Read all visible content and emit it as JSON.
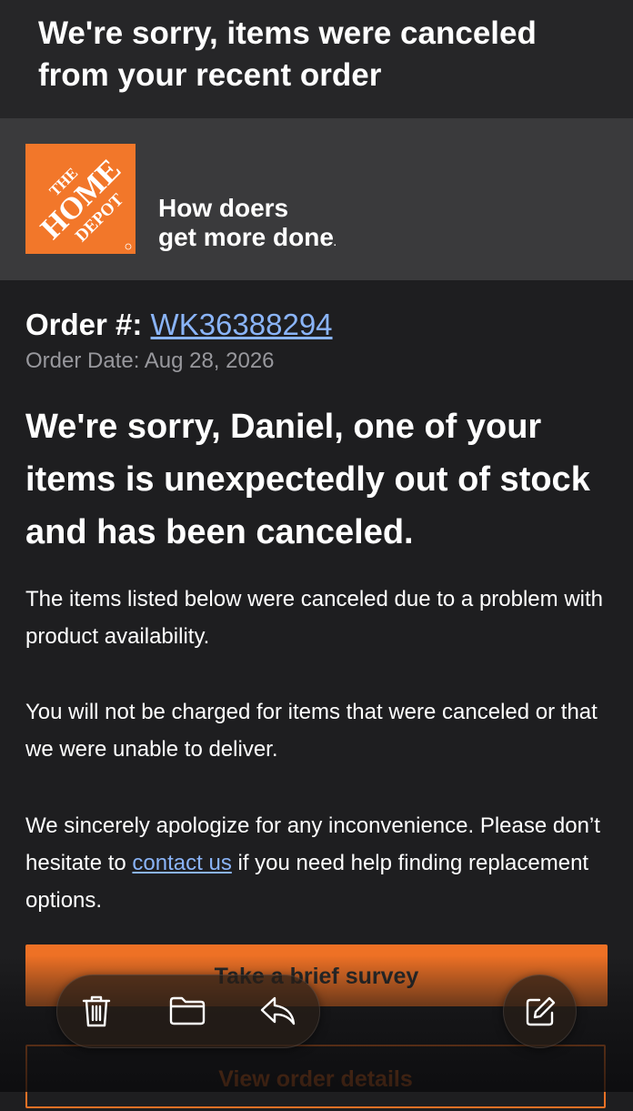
{
  "subject": {
    "title": "We're sorry, items were canceled from your recent order"
  },
  "banner": {
    "logo_text": [
      "THE",
      "HOME",
      "DEPOT"
    ],
    "tagline_line1": "How doers",
    "tagline_line2": "get more done",
    "tagline_mark": "."
  },
  "order": {
    "label": "Order #:",
    "number": "WK36388294",
    "date_label": "Order Date:",
    "date": "Aug 28, 2026"
  },
  "body": {
    "headline": "We're sorry, Daniel, one of your items is unexpectedly out of stock and has been canceled.",
    "paragraph1": "The items listed below were canceled due to a problem with product availability.",
    "paragraph2": "You will not be charged for items that were canceled or that we were unable to deliver.",
    "paragraph3_before": "We sincerely apologize for any inconvenience. Please don’t hesitate to",
    "paragraph3_link": "contact us",
    "paragraph3_after": "if you need help finding replacement options."
  },
  "buttons": {
    "survey_label": "Take a brief survey",
    "details_label": "View order details"
  },
  "toolbar": {
    "icons": [
      "trash-icon",
      "folder-icon",
      "reply-icon",
      "compose-icon"
    ]
  },
  "colors": {
    "brand_orange": "#ee7125",
    "link_blue": "#8ab4f8",
    "background": "#1e1e20"
  }
}
